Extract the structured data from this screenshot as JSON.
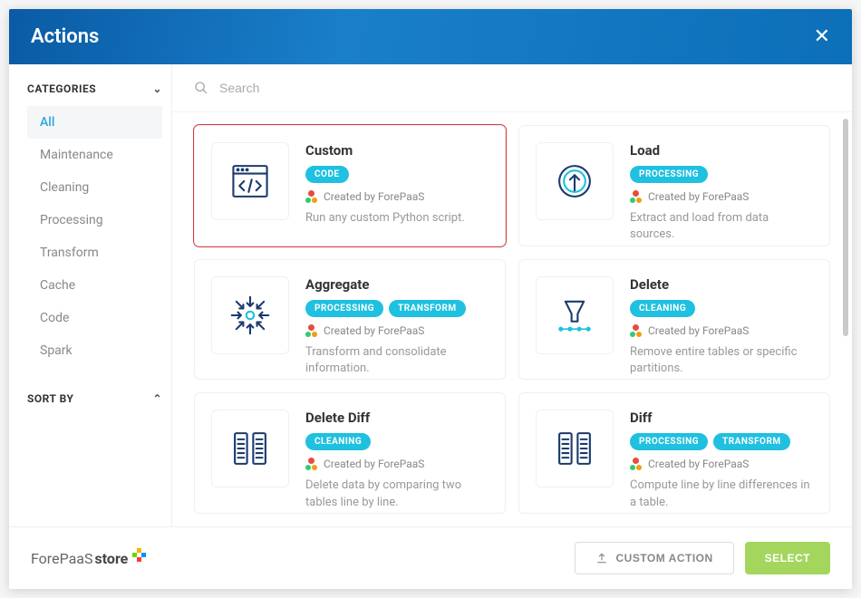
{
  "header": {
    "title": "Actions"
  },
  "search": {
    "placeholder": "Search"
  },
  "sidebar": {
    "categories_label": "CATEGORIES",
    "sort_by_label": "SORT BY",
    "categories": [
      {
        "label": "All",
        "active": true
      },
      {
        "label": "Maintenance",
        "active": false
      },
      {
        "label": "Cleaning",
        "active": false
      },
      {
        "label": "Processing",
        "active": false
      },
      {
        "label": "Transform",
        "active": false
      },
      {
        "label": "Cache",
        "active": false
      },
      {
        "label": "Code",
        "active": false
      },
      {
        "label": "Spark",
        "active": false
      }
    ]
  },
  "cards": [
    {
      "title": "Custom",
      "tags": [
        "CODE"
      ],
      "creator": "Created by ForePaaS",
      "desc": "Run any custom Python script.",
      "icon": "code-window",
      "highlighted": true
    },
    {
      "title": "Load",
      "tags": [
        "PROCESSING"
      ],
      "creator": "Created by ForePaaS",
      "desc": "Extract and load from data sources.",
      "icon": "load-circle",
      "highlighted": false
    },
    {
      "title": "Aggregate",
      "tags": [
        "PROCESSING",
        "TRANSFORM"
      ],
      "creator": "Created by ForePaaS",
      "desc": "Transform and consolidate information.",
      "icon": "aggregate",
      "highlighted": false
    },
    {
      "title": "Delete",
      "tags": [
        "CLEANING"
      ],
      "creator": "Created by ForePaaS",
      "desc": "Remove entire tables or specific partitions.",
      "icon": "delete-funnel",
      "highlighted": false
    },
    {
      "title": "Delete Diff",
      "tags": [
        "CLEANING"
      ],
      "creator": "Created by ForePaaS",
      "desc": "Delete data by comparing two tables line by line.",
      "icon": "two-tables",
      "highlighted": false
    },
    {
      "title": "Diff",
      "tags": [
        "PROCESSING",
        "TRANSFORM"
      ],
      "creator": "Created by ForePaaS",
      "desc": "Compute line by line differences in a table.",
      "icon": "two-tables",
      "highlighted": false
    }
  ],
  "footer": {
    "brand_fore": "ForePaaS",
    "brand_store": "store",
    "custom_action_label": "CUSTOM ACTION",
    "select_label": "SELECT"
  }
}
